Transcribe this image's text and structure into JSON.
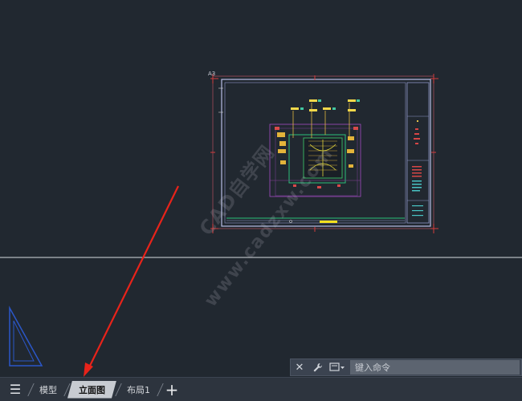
{
  "drawing": {
    "sheet_label": "A3"
  },
  "watermark": {
    "line1": "CAD自学网",
    "line2": "www.cadzxw.com"
  },
  "command": {
    "placeholder": "键入命令"
  },
  "tabs": [
    {
      "label": "模型",
      "active": false
    },
    {
      "label": "立面图",
      "active": true
    },
    {
      "label": "布局1",
      "active": false
    }
  ],
  "colors": {
    "background": "#212830",
    "arrow": "#e8231a",
    "frame": "#b8bfe6",
    "crosshair": "#e6e6ea"
  }
}
